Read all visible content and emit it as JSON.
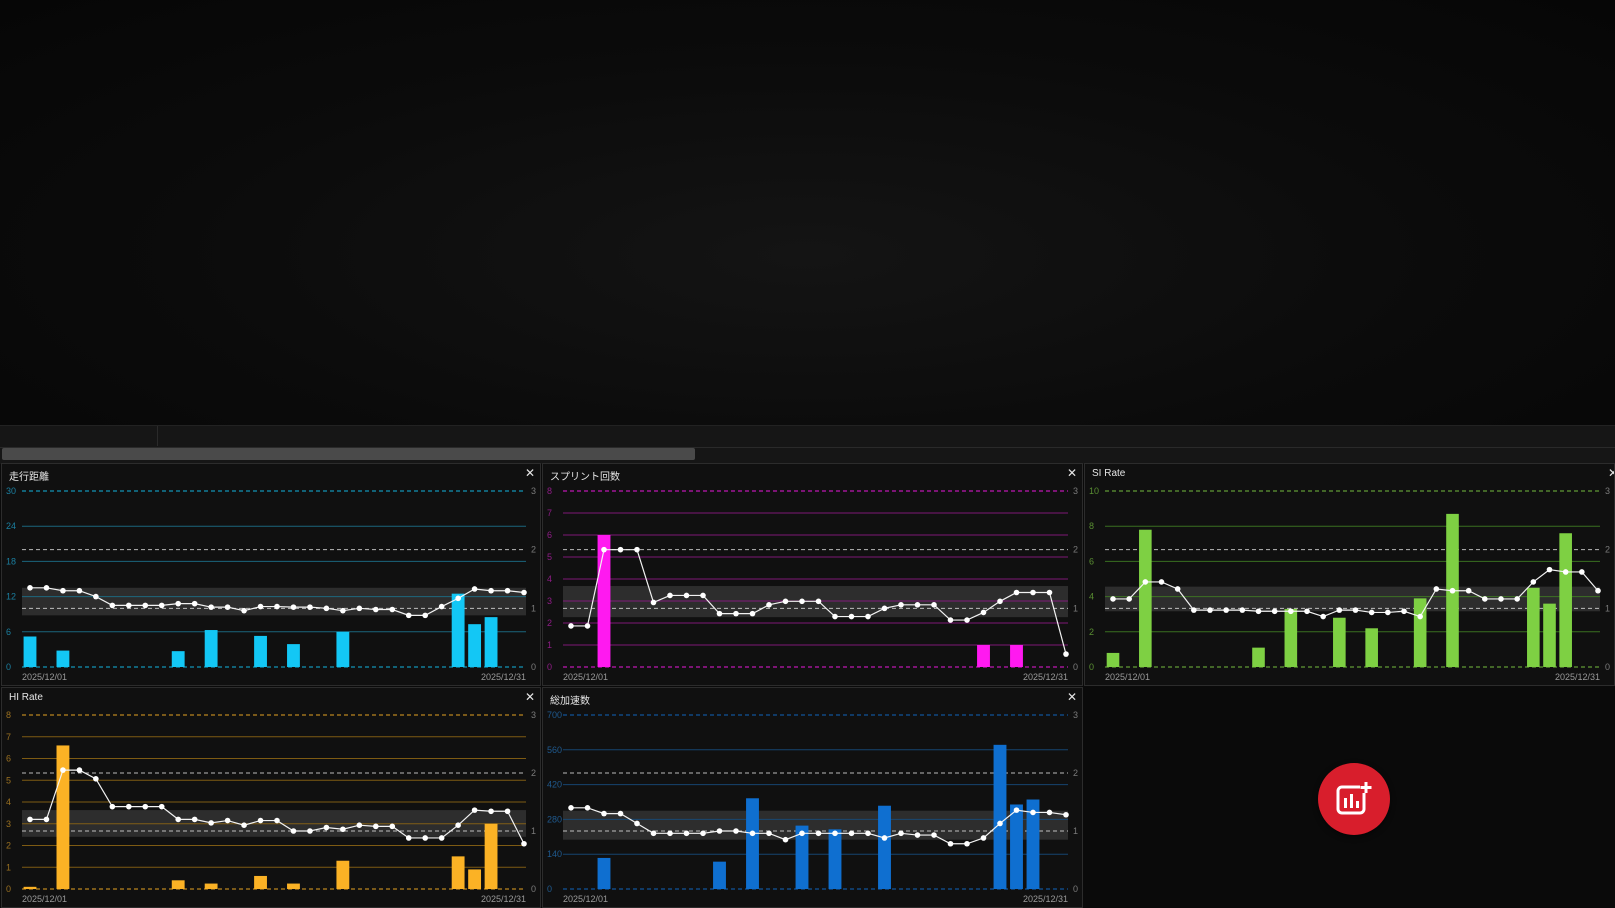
{
  "timeline": {
    "scroll_position": 0.43
  },
  "panels": [
    {
      "id": "distance",
      "title": "走行距離",
      "close": "✕",
      "color": "#13c7f5",
      "grid_color": "#1c6f88",
      "tick_color": "#1b7fa0",
      "right_tick_color": "#7a7a7a"
    },
    {
      "id": "sprint",
      "title": "スプリント回数",
      "close": "✕",
      "color": "#ff19f0",
      "grid_color": "#8a1a82",
      "tick_color": "#8e1c86",
      "right_tick_color": "#7a7a7a"
    },
    {
      "id": "si",
      "title": "SI Rate",
      "close": "✕",
      "color": "#7ed043",
      "grid_color": "#3f7a22",
      "tick_color": "#5a8f32",
      "right_tick_color": "#7a7a7a"
    },
    {
      "id": "hi",
      "title": "HI Rate",
      "close": "✕",
      "color": "#fbb225",
      "grid_color": "#8a6414",
      "tick_color": "#9a7020",
      "right_tick_color": "#7a7a7a"
    },
    {
      "id": "accel",
      "title": "総加速数",
      "close": "✕",
      "color": "#0f6fd0",
      "grid_color": "#174a7a",
      "tick_color": "#1f5a8f",
      "right_tick_color": "#7a7a7a"
    }
  ],
  "add_chart_icon": "add-chart-icon",
  "chart_data": [
    {
      "panel": "distance",
      "type": "bar",
      "title": "走行距離",
      "x_start": "2025/12/01",
      "x_end": "2025/12/31",
      "left_ticks": [
        "30",
        "24",
        "18",
        "12",
        "6",
        "0"
      ],
      "right_ticks": [
        "3",
        "2",
        "1",
        "0"
      ],
      "ylim": [
        0,
        30
      ],
      "y2lim": [
        0,
        3
      ],
      "band": [
        0.88,
        1.35
      ],
      "bars": [
        5.2,
        0,
        2.8,
        0,
        0,
        0,
        0,
        0,
        0,
        2.7,
        0,
        6.3,
        0,
        0,
        5.3,
        0,
        3.9,
        0,
        0,
        6.0,
        0,
        0,
        0,
        0,
        0,
        0,
        12.5,
        7.3,
        8.5,
        0,
        0
      ],
      "line": [
        1.35,
        1.35,
        1.3,
        1.3,
        1.2,
        1.05,
        1.05,
        1.05,
        1.05,
        1.08,
        1.08,
        1.02,
        1.02,
        0.96,
        1.03,
        1.03,
        1.02,
        1.02,
        1.0,
        0.96,
        1.0,
        0.98,
        0.98,
        0.88,
        0.88,
        1.03,
        1.17,
        1.33,
        1.3,
        1.3,
        1.27
      ]
    },
    {
      "panel": "sprint",
      "type": "bar",
      "title": "スプリント回数",
      "x_start": "2025/12/01",
      "x_end": "2025/12/31",
      "left_ticks": [
        "8",
        "7",
        "6",
        "5",
        "4",
        "3",
        "2",
        "1",
        "0"
      ],
      "right_ticks": [
        "3",
        "2",
        "1",
        "0"
      ],
      "ylim": [
        0,
        8
      ],
      "y2lim": [
        0,
        3
      ],
      "band": [
        0.85,
        1.38
      ],
      "bars": [
        0,
        0,
        6,
        0,
        0,
        0,
        0,
        0,
        0,
        0,
        0,
        0,
        0,
        0,
        0,
        0,
        0,
        0,
        0,
        0,
        0,
        0,
        0,
        0,
        0,
        1,
        0,
        1,
        0,
        0,
        0
      ],
      "line": [
        0.7,
        0.7,
        2.0,
        2.0,
        2.0,
        1.1,
        1.22,
        1.22,
        1.22,
        0.91,
        0.91,
        0.91,
        1.06,
        1.12,
        1.12,
        1.12,
        0.86,
        0.86,
        0.86,
        1.0,
        1.06,
        1.06,
        1.06,
        0.8,
        0.8,
        0.93,
        1.12,
        1.27,
        1.27,
        1.27,
        0.22
      ]
    },
    {
      "panel": "si",
      "type": "bar",
      "title": "SI Rate",
      "x_start": "2025/12/01",
      "x_end": "2025/12/31",
      "left_ticks": [
        "10",
        "8",
        "6",
        "4",
        "2",
        "0"
      ],
      "right_ticks": [
        "3",
        "2",
        "1",
        "0"
      ],
      "ylim": [
        0,
        10
      ],
      "y2lim": [
        0,
        3
      ],
      "band": [
        0.95,
        1.37
      ],
      "bars": [
        0.8,
        0,
        7.8,
        0,
        0,
        0,
        0,
        0,
        0,
        1.1,
        0,
        3.3,
        0,
        0,
        2.8,
        0,
        2.2,
        0,
        0,
        3.9,
        0,
        8.7,
        0,
        0,
        0,
        0,
        4.5,
        3.6,
        7.6,
        0,
        0
      ],
      "line": [
        1.16,
        1.16,
        1.45,
        1.45,
        1.33,
        0.97,
        0.97,
        0.97,
        0.97,
        0.95,
        0.95,
        0.95,
        0.95,
        0.86,
        0.97,
        0.97,
        0.93,
        0.93,
        0.95,
        0.86,
        1.33,
        1.3,
        1.3,
        1.16,
        1.16,
        1.16,
        1.45,
        1.66,
        1.62,
        1.62,
        1.3
      ]
    },
    {
      "panel": "hi",
      "type": "bar",
      "title": "HI Rate",
      "x_start": "2025/12/01",
      "x_end": "2025/12/31",
      "left_ticks": [
        "8",
        "7",
        "6",
        "5",
        "4",
        "3",
        "2",
        "1",
        "0"
      ],
      "right_ticks": [
        "3",
        "2",
        "1",
        "0"
      ],
      "ylim": [
        0,
        8
      ],
      "y2lim": [
        0,
        3
      ],
      "band": [
        0.9,
        1.36
      ],
      "bars": [
        0.1,
        0,
        6.6,
        0,
        0,
        0,
        0,
        0,
        0,
        0.4,
        0,
        0.25,
        0,
        0,
        0.6,
        0,
        0.25,
        0,
        0,
        1.3,
        0,
        0,
        0,
        0,
        0,
        0,
        1.5,
        0.9,
        3.0,
        0,
        0
      ],
      "line": [
        1.2,
        1.2,
        2.05,
        2.05,
        1.9,
        1.42,
        1.42,
        1.42,
        1.42,
        1.2,
        1.2,
        1.14,
        1.18,
        1.1,
        1.18,
        1.18,
        1.0,
        1.0,
        1.06,
        1.03,
        1.1,
        1.08,
        1.08,
        0.88,
        0.88,
        0.88,
        1.1,
        1.36,
        1.34,
        1.34,
        0.78
      ]
    },
    {
      "panel": "accel",
      "type": "bar",
      "title": "総加速数",
      "x_start": "2025/12/01",
      "x_end": "2025/12/31",
      "left_ticks": [
        "700",
        "560",
        "420",
        "280",
        "140",
        "0"
      ],
      "right_ticks": [
        "3",
        "2",
        "1",
        "0"
      ],
      "ylim": [
        0,
        700
      ],
      "y2lim": [
        0,
        3
      ],
      "band": [
        0.85,
        1.35
      ],
      "bars": [
        0,
        0,
        125,
        0,
        0,
        0,
        0,
        0,
        0,
        110,
        0,
        365,
        0,
        0,
        255,
        0,
        240,
        0,
        0,
        335,
        0,
        0,
        0,
        0,
        0,
        0,
        580,
        340,
        360,
        0,
        0
      ],
      "line": [
        1.4,
        1.4,
        1.3,
        1.3,
        1.13,
        0.96,
        0.96,
        0.96,
        0.96,
        1.0,
        1.0,
        0.96,
        0.96,
        0.85,
        0.96,
        0.96,
        0.96,
        0.96,
        0.96,
        0.88,
        0.96,
        0.93,
        0.93,
        0.78,
        0.78,
        0.88,
        1.13,
        1.36,
        1.32,
        1.32,
        1.28
      ]
    }
  ]
}
